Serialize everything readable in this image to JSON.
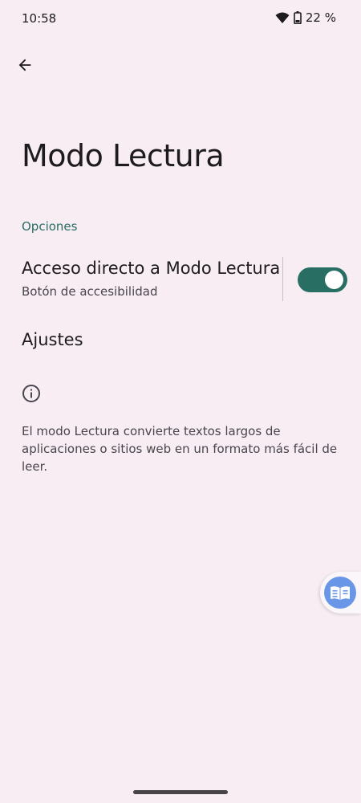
{
  "status_bar": {
    "time": "10:58",
    "battery": "22 %",
    "icons": [
      "wifi-icon",
      "battery-icon"
    ]
  },
  "header": {
    "back_icon": "arrow-back-icon",
    "title": "Modo Lectura"
  },
  "options_section": {
    "header": "Opciones",
    "shortcut": {
      "title": "Acceso directo a Modo Lectura",
      "summary": "Botón de accesibilidad",
      "toggle_on": true
    },
    "settings": {
      "title": "Ajustes"
    }
  },
  "footer": {
    "icon": "info-icon",
    "text": "El modo Lectura convierte textos largos de aplicaciones o sitios web en un formato más fácil de leer."
  },
  "floating_button": {
    "icon": "reading-mode-icon"
  },
  "colors": {
    "background": "#f7edf3",
    "accent": "#286e63",
    "float_button": "#6a96e7"
  }
}
